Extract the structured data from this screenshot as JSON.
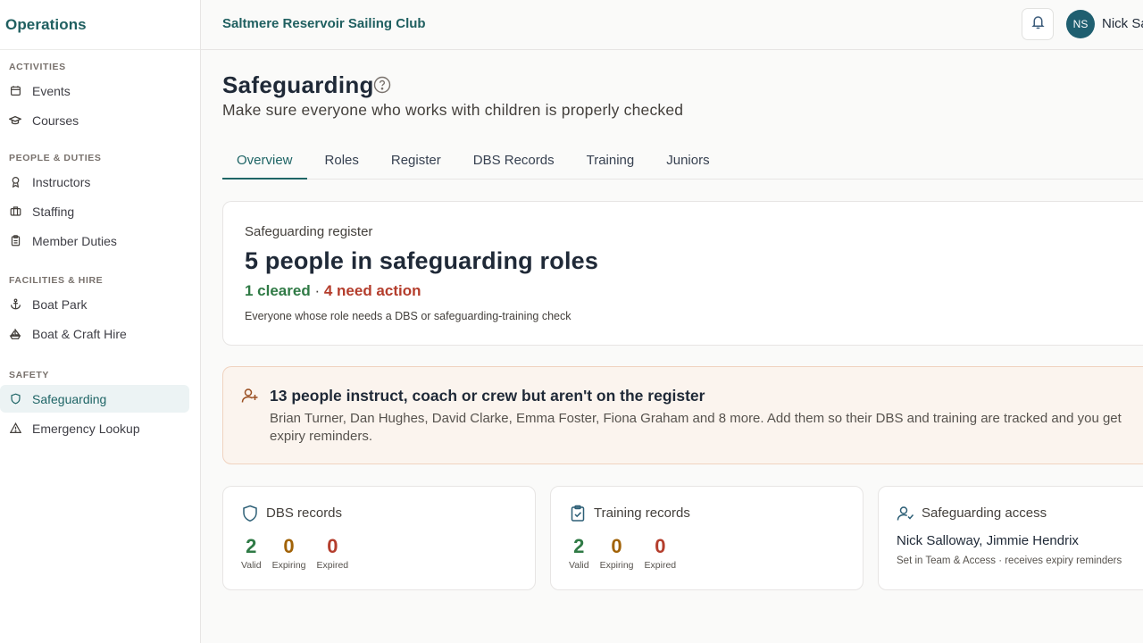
{
  "sidebar": {
    "title": "Operations",
    "sections": [
      {
        "heading": "ACTIVITIES",
        "items": [
          {
            "label": "Events",
            "icon": "calendar-icon"
          },
          {
            "label": "Courses",
            "icon": "graduation-cap-icon"
          }
        ]
      },
      {
        "heading": "PEOPLE & DUTIES",
        "items": [
          {
            "label": "Instructors",
            "icon": "award-icon"
          },
          {
            "label": "Staffing",
            "icon": "briefcase-icon"
          },
          {
            "label": "Member Duties",
            "icon": "clipboard-icon"
          }
        ]
      },
      {
        "heading": "FACILITIES & HIRE",
        "items": [
          {
            "label": "Boat Park",
            "icon": "anchor-icon"
          },
          {
            "label": "Boat & Craft Hire",
            "icon": "sailboat-icon"
          }
        ]
      },
      {
        "heading": "SAFETY",
        "items": [
          {
            "label": "Safeguarding",
            "icon": "shield-icon",
            "active": true
          },
          {
            "label": "Emergency Lookup",
            "icon": "warning-icon"
          }
        ]
      }
    ]
  },
  "header": {
    "club_name": "Saltmere Reservoir Sailing Club",
    "user_initials": "NS",
    "user_name": "Nick Sa"
  },
  "page": {
    "title": "Safeguarding",
    "subtitle": "Make sure everyone who works with children is properly checked"
  },
  "tabs": [
    "Overview",
    "Roles",
    "Register",
    "DBS Records",
    "Training",
    "Juniors"
  ],
  "active_tab": "Overview",
  "register": {
    "label": "Safeguarding register",
    "headline": "5 people in safeguarding roles",
    "cleared": "1 cleared",
    "separator": " · ",
    "need_action": "4 need action",
    "note": "Everyone whose role needs a DBS or safeguarding-training check"
  },
  "alert": {
    "title": "13 people instruct, coach or crew but aren't on the register",
    "text": "Brian Turner, Dan Hughes, David Clarke, Emma Foster, Fiona Graham and 8 more. Add them so their DBS and training are tracked and you get expiry reminders."
  },
  "dbs": {
    "title": "DBS records",
    "valid": "2",
    "valid_label": "Valid",
    "expiring": "0",
    "expiring_label": "Expiring",
    "expired": "0",
    "expired_label": "Expired"
  },
  "training": {
    "title": "Training records",
    "valid": "2",
    "valid_label": "Valid",
    "expiring": "0",
    "expiring_label": "Expiring",
    "expired": "0",
    "expired_label": "Expired"
  },
  "access": {
    "title": "Safeguarding access",
    "names": "Nick Salloway, Jimmie Hendrix",
    "note": "Set in Team & Access · receives expiry reminders"
  },
  "colors": {
    "brand": "#1f5f60",
    "valid": "#2f7a45",
    "expiring": "#a16207",
    "expired": "#b43d2c",
    "alert_bg": "#fbf4ee"
  }
}
